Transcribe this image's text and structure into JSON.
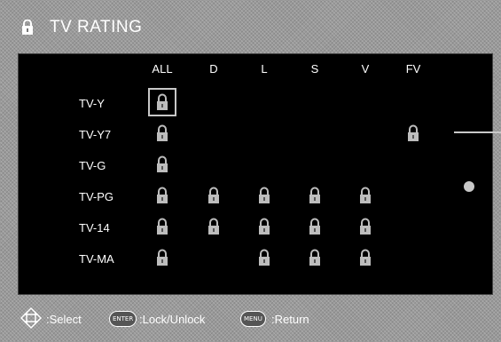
{
  "header": {
    "title": "TV RATING"
  },
  "columns": [
    "ALL",
    "D",
    "L",
    "S",
    "V",
    "FV"
  ],
  "rows": [
    {
      "label": "TV-Y",
      "locks": [
        true,
        false,
        false,
        false,
        false,
        false
      ]
    },
    {
      "label": "TV-Y7",
      "locks": [
        true,
        false,
        false,
        false,
        false,
        true
      ]
    },
    {
      "label": "TV-G",
      "locks": [
        true,
        false,
        false,
        false,
        false,
        false
      ]
    },
    {
      "label": "TV-PG",
      "locks": [
        true,
        true,
        true,
        true,
        true,
        false
      ]
    },
    {
      "label": "TV-14",
      "locks": [
        true,
        true,
        true,
        true,
        true,
        false
      ]
    },
    {
      "label": "TV-MA",
      "locks": [
        true,
        false,
        true,
        true,
        true,
        false
      ]
    }
  ],
  "selected_cell": {
    "row": 0,
    "col": 0
  },
  "footer": {
    "select_label": ":Select",
    "enter_key": "ENTER",
    "lock_label": ":Lock/Unlock",
    "menu_key": "MENU",
    "return_label": ":Return"
  },
  "icons": {
    "lock": "lock-icon",
    "navigation": "navigation-arrows-icon"
  },
  "colors": {
    "panel": "#000000",
    "text": "#ffffff",
    "selection": "#c8c8c8"
  }
}
